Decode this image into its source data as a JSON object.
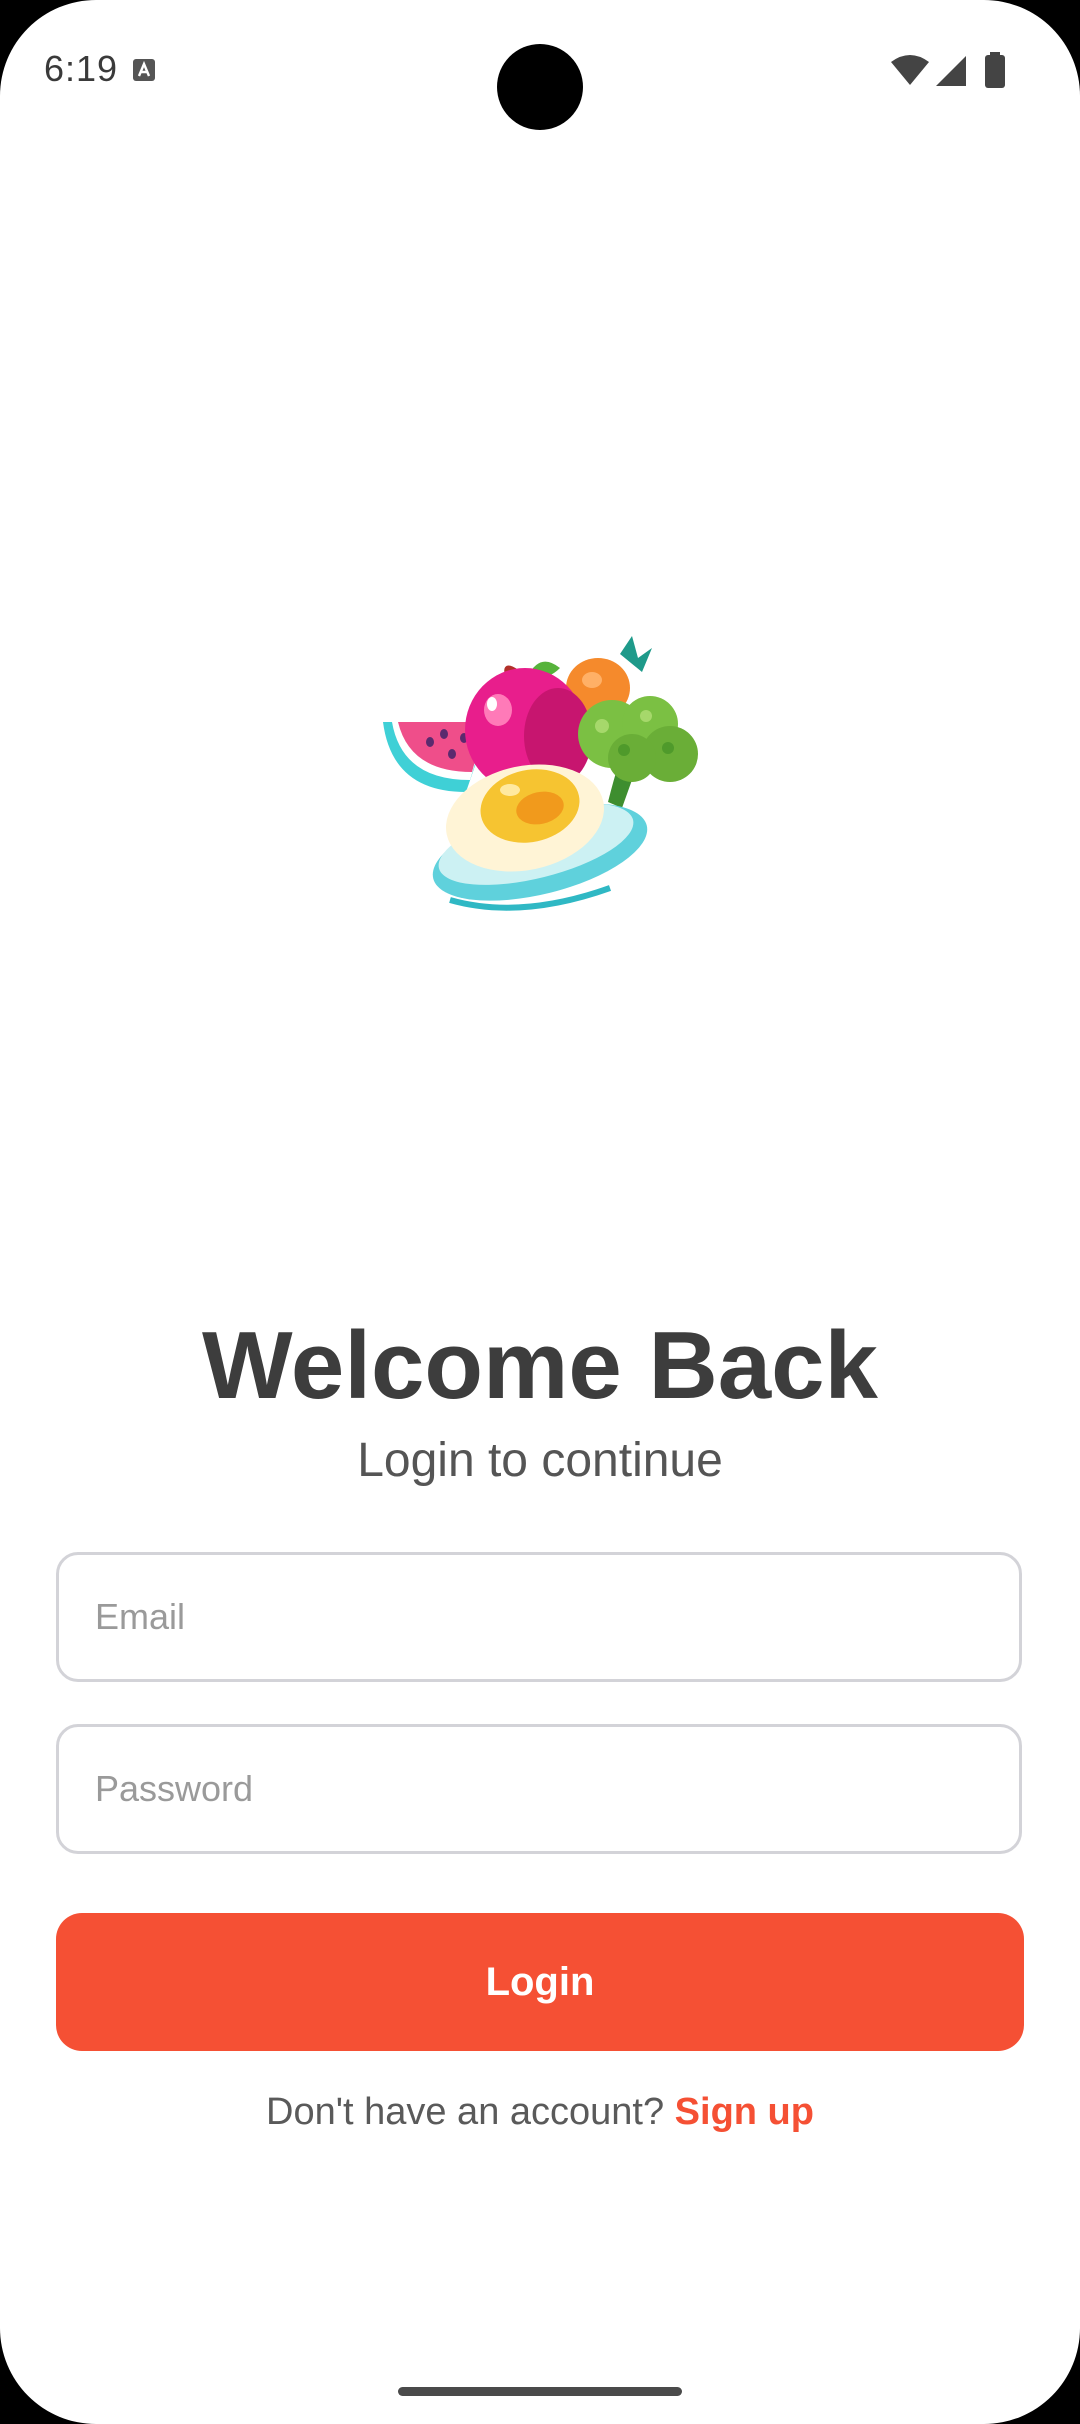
{
  "status_bar": {
    "time": "6:19",
    "icons": [
      "a-keyboard-icon",
      "wifi-icon",
      "signal-icon",
      "battery-icon"
    ]
  },
  "illustration": {
    "icon": "food-illustration-icon",
    "colors": {
      "accent": "#f55034",
      "watermelon": "#ef4e8a",
      "apple": "#e81e8c",
      "broccoli": "#7bc043",
      "egg_yolk": "#f6c431",
      "plate": "#5fd1dc"
    }
  },
  "header": {
    "title": "Welcome Back",
    "subtitle": "Login to continue"
  },
  "form": {
    "email_placeholder": "Email",
    "email_value": "",
    "password_placeholder": "Password",
    "password_value": "",
    "login_label": "Login"
  },
  "signup": {
    "prompt": "Don't have an account?",
    "link_label": "Sign up"
  },
  "theme": {
    "accent": "#f55034",
    "title_color": "#3d3d3d",
    "input_border": "#d3d3d8"
  }
}
